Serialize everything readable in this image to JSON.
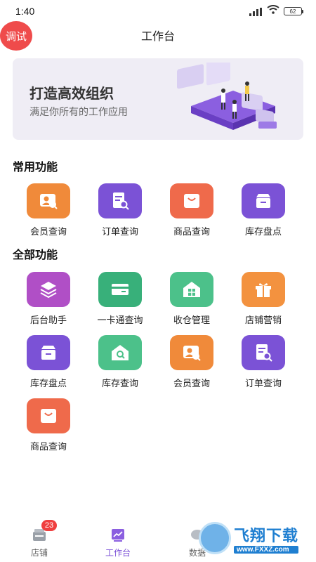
{
  "status_bar": {
    "time": "1:40",
    "battery": "62"
  },
  "header": {
    "title": "工作台",
    "debug_label": "调试"
  },
  "banner": {
    "title": "打造高效组织",
    "subtitle": "满足你所有的工作应用"
  },
  "common": {
    "title": "常用功能",
    "items": [
      {
        "label": "会员查询",
        "icon": "member-search-icon",
        "color": "#f08a3a"
      },
      {
        "label": "订单查询",
        "icon": "order-search-icon",
        "color": "#7b52d6"
      },
      {
        "label": "商品查询",
        "icon": "product-bag-icon",
        "color": "#ef6a4b"
      },
      {
        "label": "库存盘点",
        "icon": "inventory-box-icon",
        "color": "#7b52d6"
      }
    ]
  },
  "all": {
    "title": "全部功能",
    "items": [
      {
        "label": "后台助手",
        "icon": "layers-icon",
        "color": "#b04fc6"
      },
      {
        "label": "一卡通查询",
        "icon": "card-icon",
        "color": "#38b07a"
      },
      {
        "label": "收仓管理",
        "icon": "warehouse-icon",
        "color": "#4cc18a"
      },
      {
        "label": "店铺营销",
        "icon": "gift-icon",
        "color": "#f3923f"
      },
      {
        "label": "库存盘点",
        "icon": "inventory-box-icon",
        "color": "#7b52d6"
      },
      {
        "label": "库存查询",
        "icon": "stock-search-icon",
        "color": "#4cc18a"
      },
      {
        "label": "会员查询",
        "icon": "member-search-icon",
        "color": "#f08a3a"
      },
      {
        "label": "订单查询",
        "icon": "order-search-icon",
        "color": "#7b52d6"
      },
      {
        "label": "商品查询",
        "icon": "product-bag-icon",
        "color": "#ef6a4b"
      }
    ]
  },
  "tabs": [
    {
      "label": "店铺",
      "icon": "store-icon",
      "badge": "23",
      "active": false
    },
    {
      "label": "工作台",
      "icon": "workbench-chart-icon",
      "active": true
    },
    {
      "label": "数据",
      "icon": "data-icon",
      "active": false
    }
  ],
  "watermark": {
    "cn": "飞翔下载",
    "url": "www.FXXZ.com"
  },
  "colors": {
    "accent": "#7a4fd6",
    "debug": "#ef4b4b",
    "badge": "#ef3f3f"
  }
}
